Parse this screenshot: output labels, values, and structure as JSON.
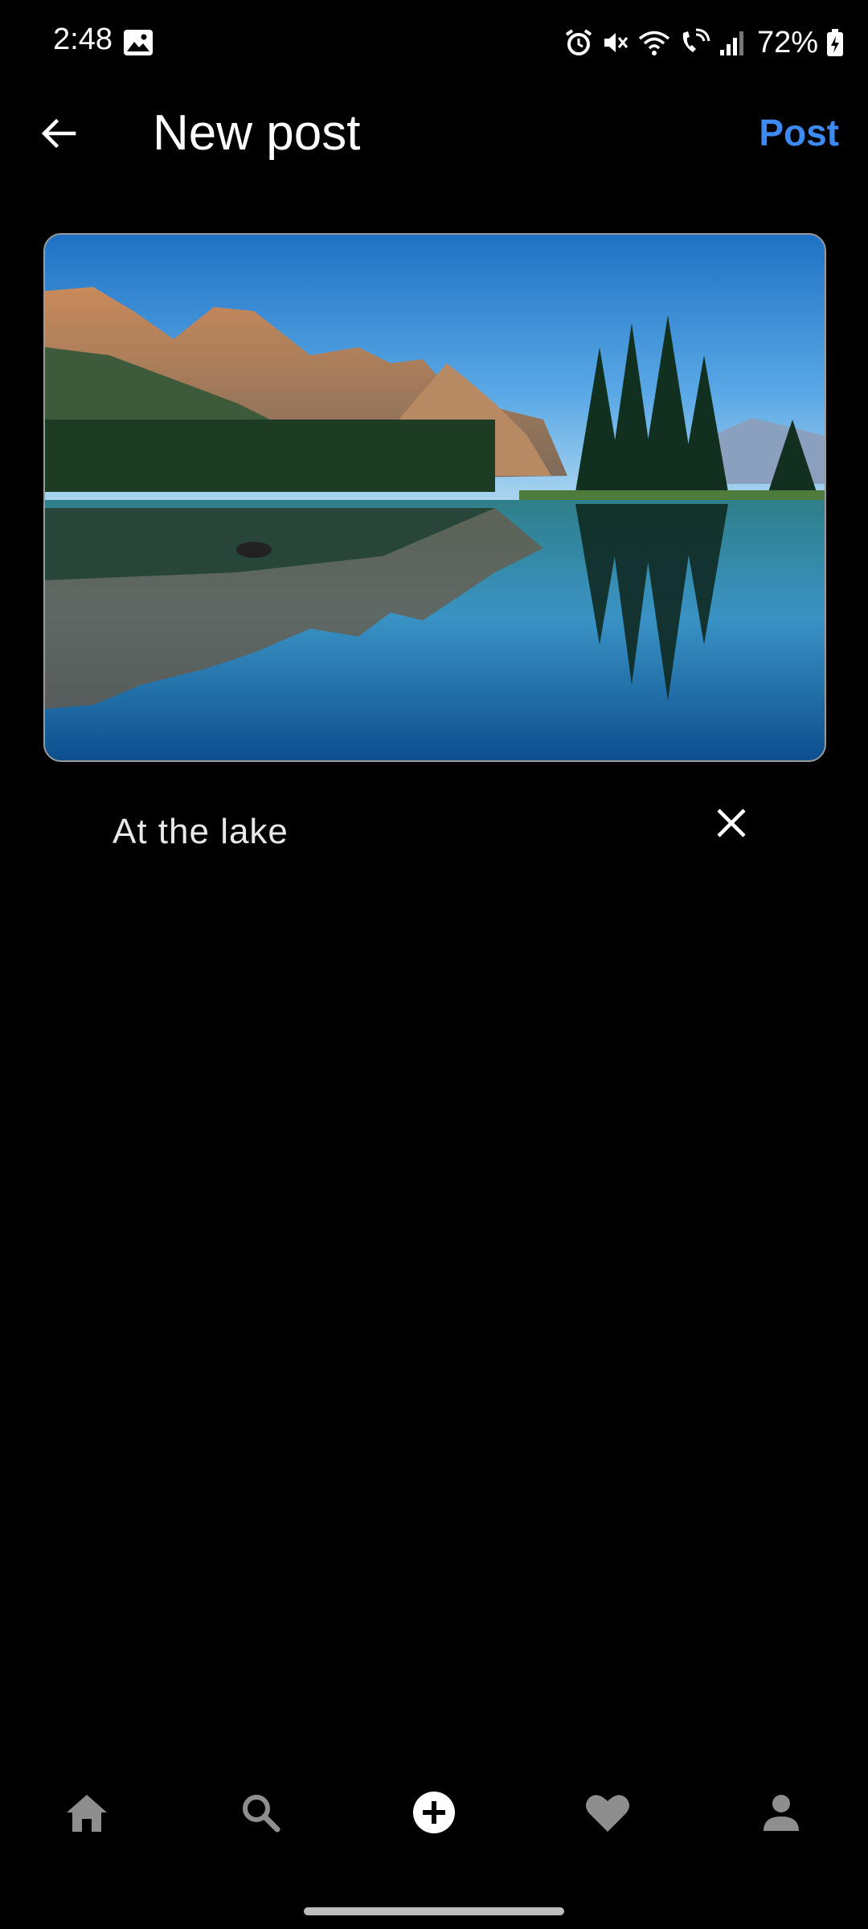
{
  "status_bar": {
    "time": "2:48",
    "battery_percent": "72%",
    "icons": [
      "gallery-icon",
      "alarm-icon",
      "mute-icon",
      "wifi-icon",
      "wifi-call-icon",
      "signal-icon",
      "battery-charging-icon"
    ]
  },
  "app_bar": {
    "title": "New post",
    "action_label": "Post",
    "back_icon": "arrow-back-icon"
  },
  "photo": {
    "subject": "mountain-lake-landscape"
  },
  "caption": {
    "text": "At the lake",
    "clear_icon": "close-icon"
  },
  "bottom_nav": {
    "items": [
      "home-icon",
      "search-icon",
      "add-circle-icon",
      "heart-icon",
      "profile-icon"
    ],
    "active": "add-circle-icon"
  },
  "colors": {
    "background": "#000000",
    "accent": "#3d8bf2",
    "nav_icon": "#8e8e8e"
  }
}
